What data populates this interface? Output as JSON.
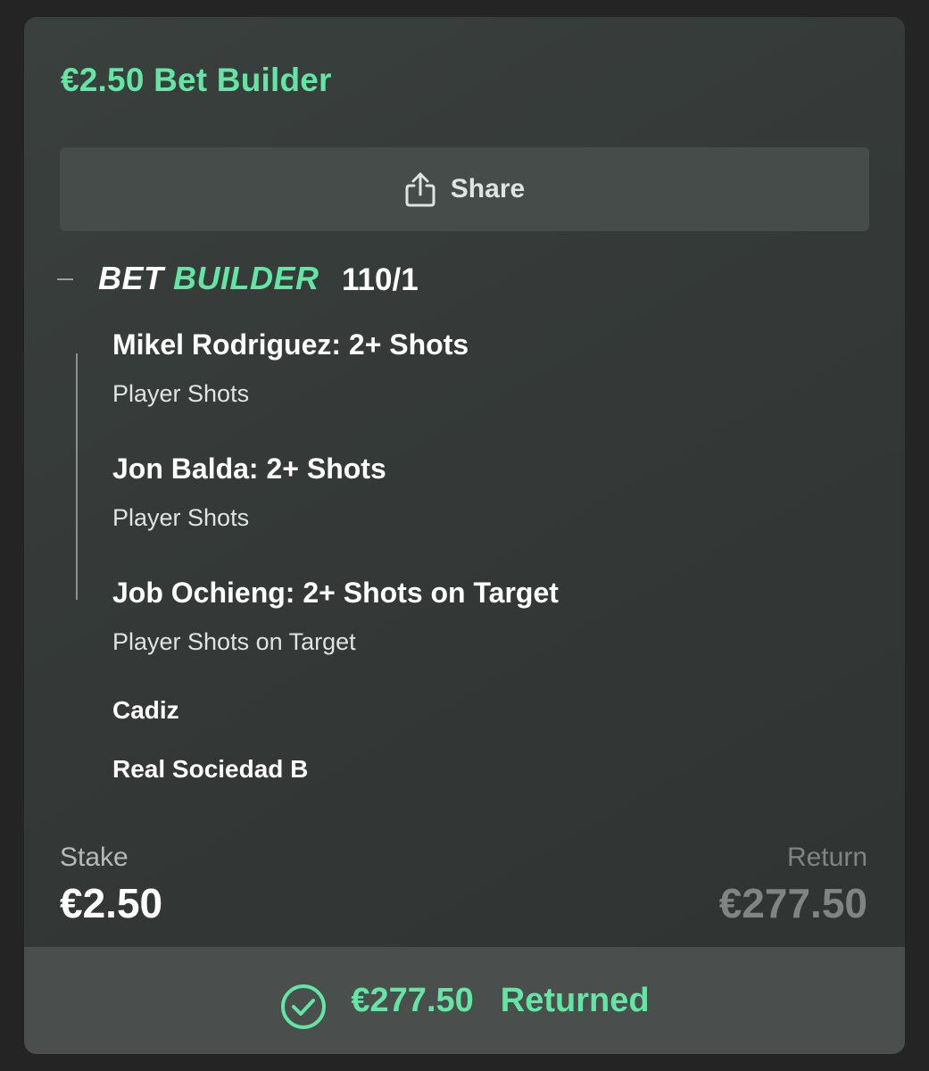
{
  "header": {
    "title": "€2.50 Bet Builder"
  },
  "share": {
    "label": "Share",
    "icon": "share-icon"
  },
  "bet_builder": {
    "logo_part1": "BET",
    "logo_part2": "BUILDER",
    "odds": "110/1",
    "selections": [
      {
        "title": "Mikel Rodriguez: 2+ Shots",
        "market": "Player Shots"
      },
      {
        "title": "Jon Balda: 2+ Shots",
        "market": "Player Shots"
      },
      {
        "title": "Job Ochieng: 2+ Shots on Target",
        "market": "Player Shots on Target"
      }
    ],
    "teams": [
      "Cadiz",
      "Real Sociedad B"
    ]
  },
  "summary": {
    "stake_label": "Stake",
    "stake_value": "€2.50",
    "return_label": "Return",
    "return_value": "€277.50"
  },
  "result": {
    "amount": "€277.50",
    "label": "Returned",
    "icon": "check-circle-icon"
  },
  "colors": {
    "accent_green": "#63e6a4",
    "card_bg": "#363b39",
    "page_bg": "#242424"
  }
}
